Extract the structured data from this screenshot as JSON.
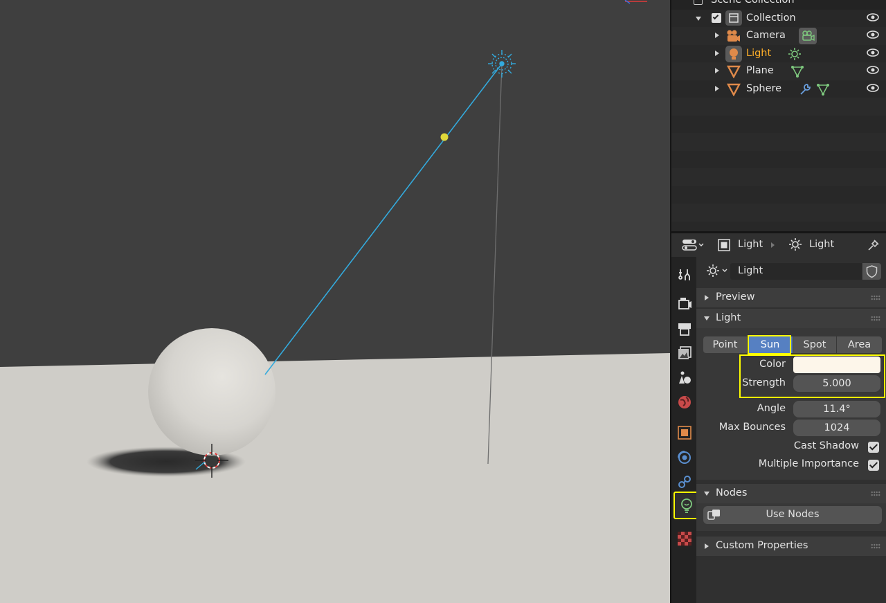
{
  "outliner": {
    "scene_collection": "Scene Collection",
    "collection": "Collection",
    "items": [
      {
        "label": "Camera"
      },
      {
        "label": "Light"
      },
      {
        "label": "Plane"
      },
      {
        "label": "Sphere"
      }
    ]
  },
  "properties": {
    "breadcrumb_object": "Light",
    "breadcrumb_data": "Light",
    "datablock_name": "Light",
    "panels": {
      "preview": "Preview",
      "light": "Light",
      "nodes": "Nodes",
      "custom_properties": "Custom Properties"
    },
    "light_types": [
      "Point",
      "Sun",
      "Spot",
      "Area"
    ],
    "selected_light_type": "Sun",
    "color_label": "Color",
    "color_value": "#fdf6ea",
    "strength_label": "Strength",
    "strength_value": "5.000",
    "angle_label": "Angle",
    "angle_value": "11.4°",
    "max_bounces_label": "Max Bounces",
    "max_bounces_value": "1024",
    "cast_shadow_label": "Cast Shadow",
    "multiple_importance_label": "Multiple Importance",
    "use_nodes_label": "Use Nodes"
  },
  "colors": {
    "highlight": "#ffff00",
    "selected_text": "#ffaf29",
    "light_line": "#33aadd"
  }
}
